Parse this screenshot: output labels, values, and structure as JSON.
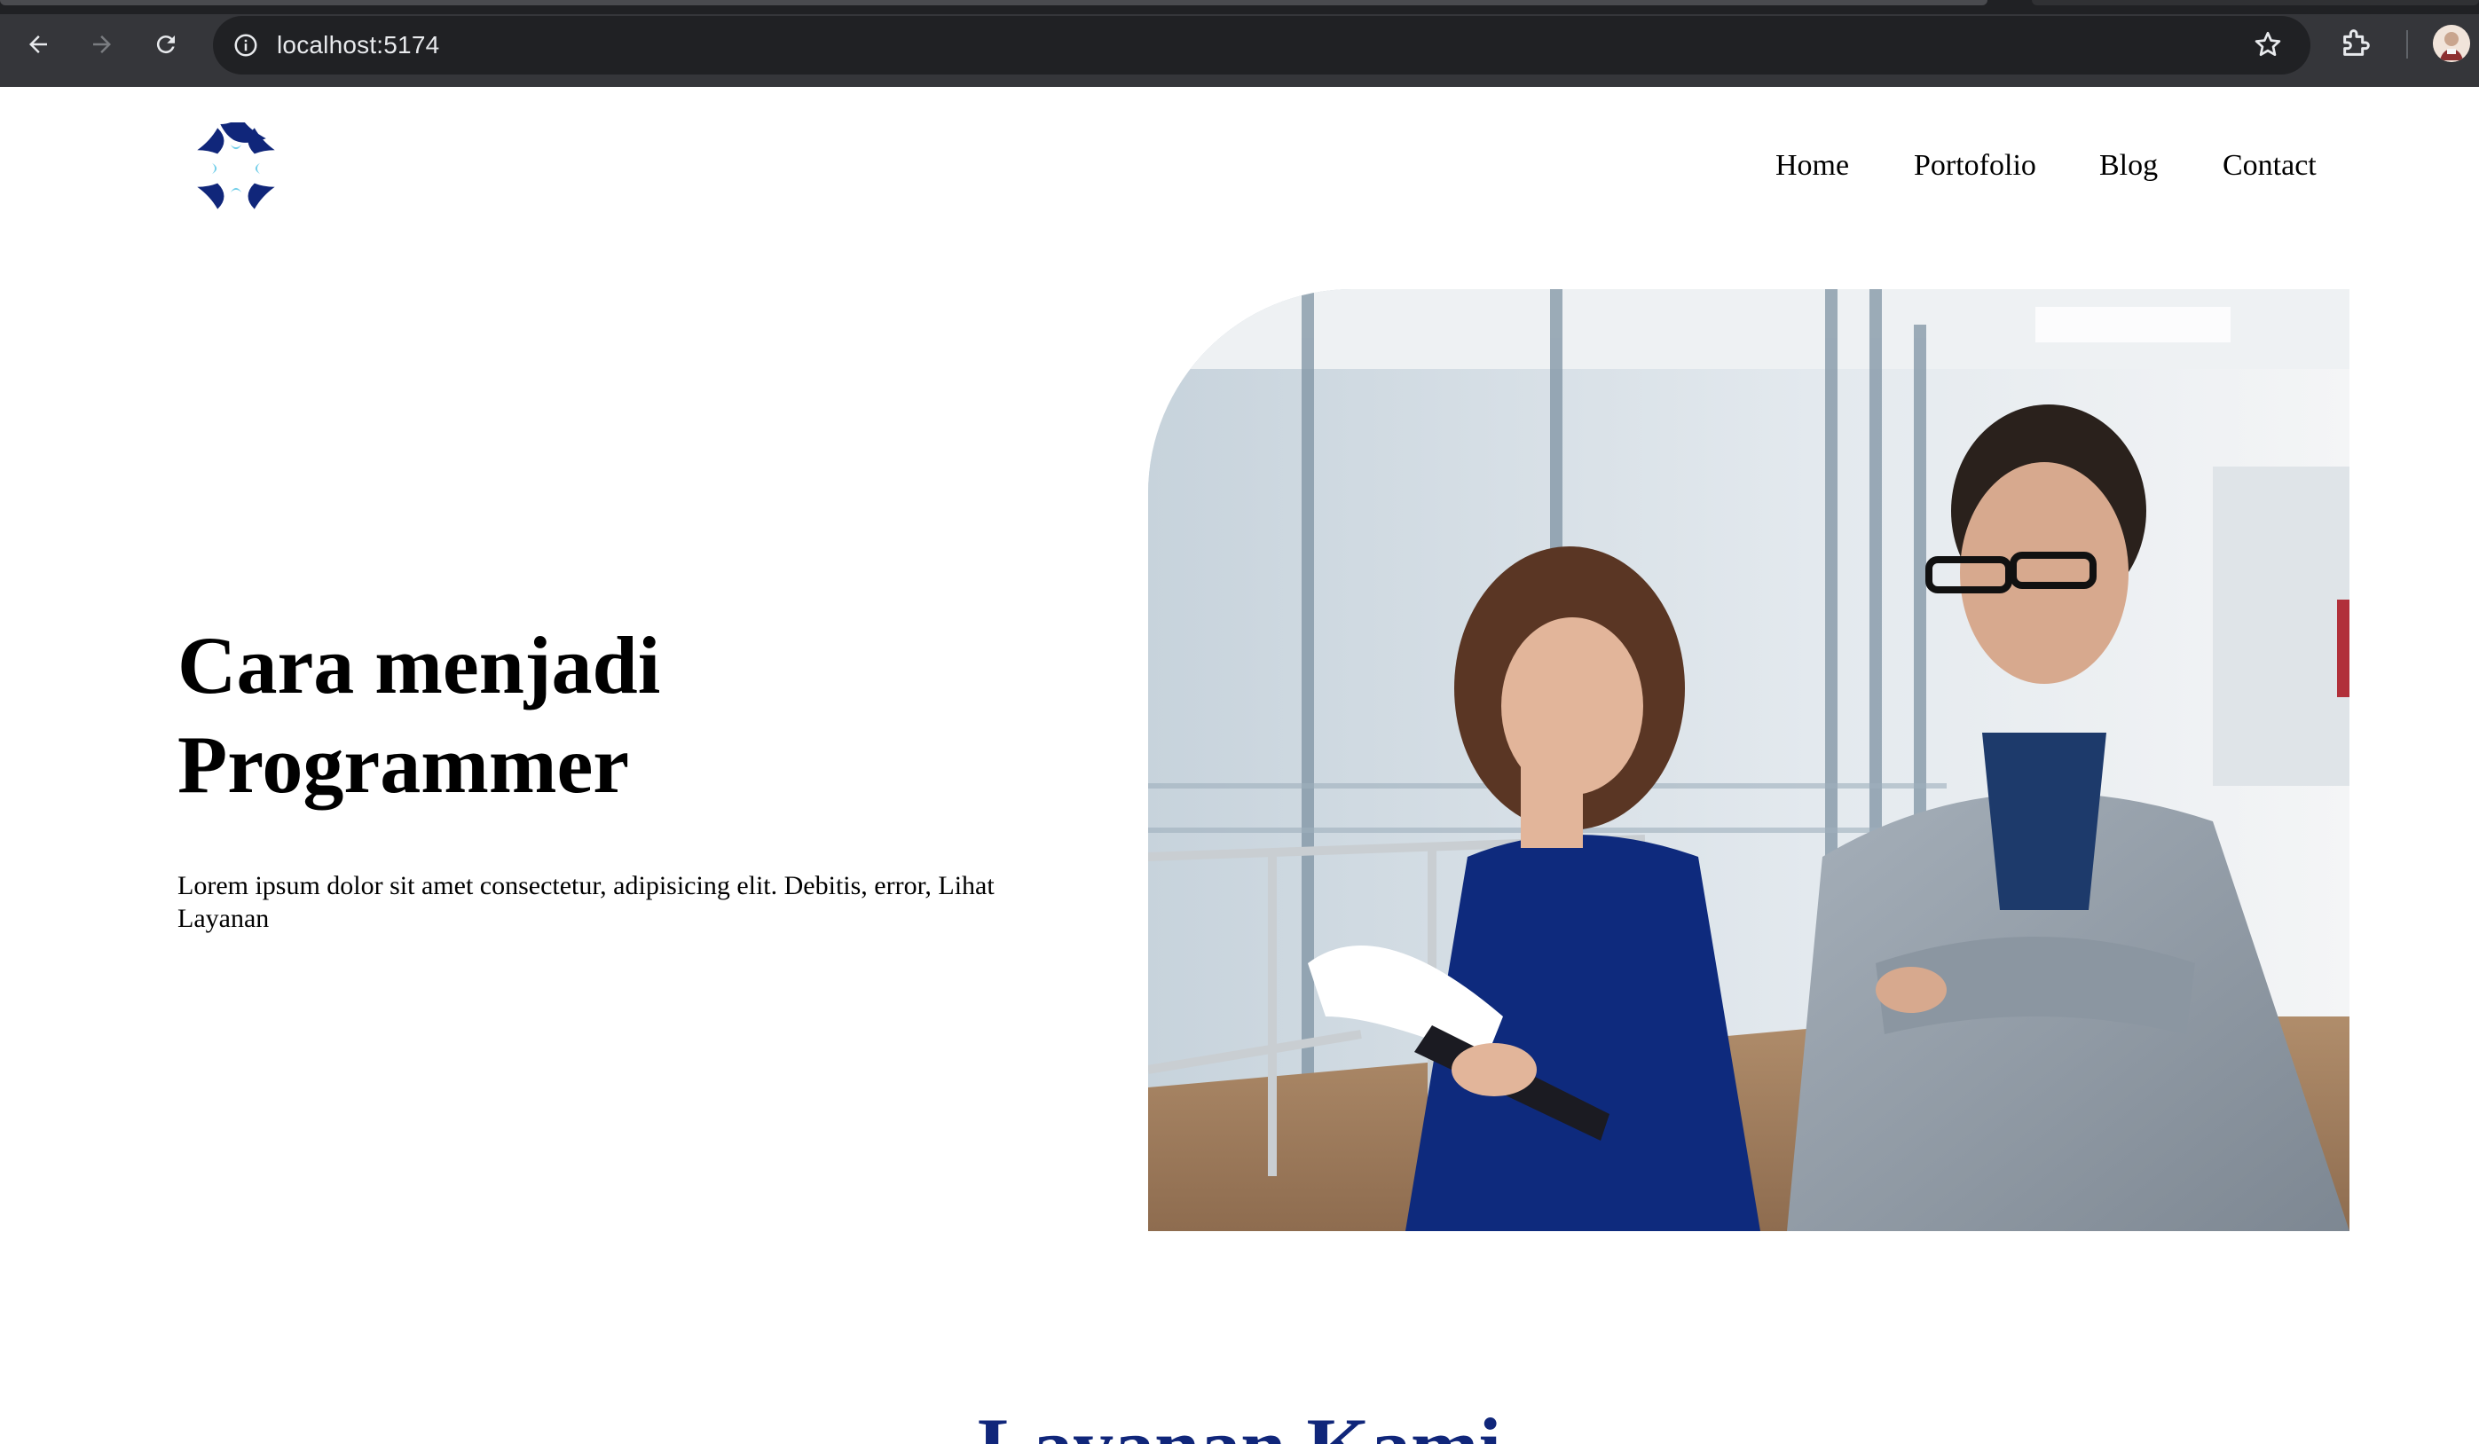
{
  "browser": {
    "url": "localhost:5174",
    "icons": {
      "back": "back-arrow-icon",
      "forward": "forward-arrow-icon",
      "reload": "reload-icon",
      "site_info": "info-icon",
      "bookmark": "star-icon",
      "extensions": "puzzle-icon",
      "profile": "avatar"
    }
  },
  "site": {
    "brand_color": "#10267a",
    "logo": "four-petal-logo",
    "nav": {
      "home": "Home",
      "portfolio": "Portofolio",
      "blog": "Blog",
      "contact": "Contact"
    }
  },
  "hero": {
    "title_line1": "Cara menjadi",
    "title_line2": "Programmer",
    "text": "Lorem ipsum dolor sit amet consectetur, adipisicing elit. Debitis, error, Lihat Layanan",
    "image": "photo of a woman holding a clipboard and a smiling man in a grey blazer in an office"
  },
  "services": {
    "title": "Layanan Kami"
  }
}
